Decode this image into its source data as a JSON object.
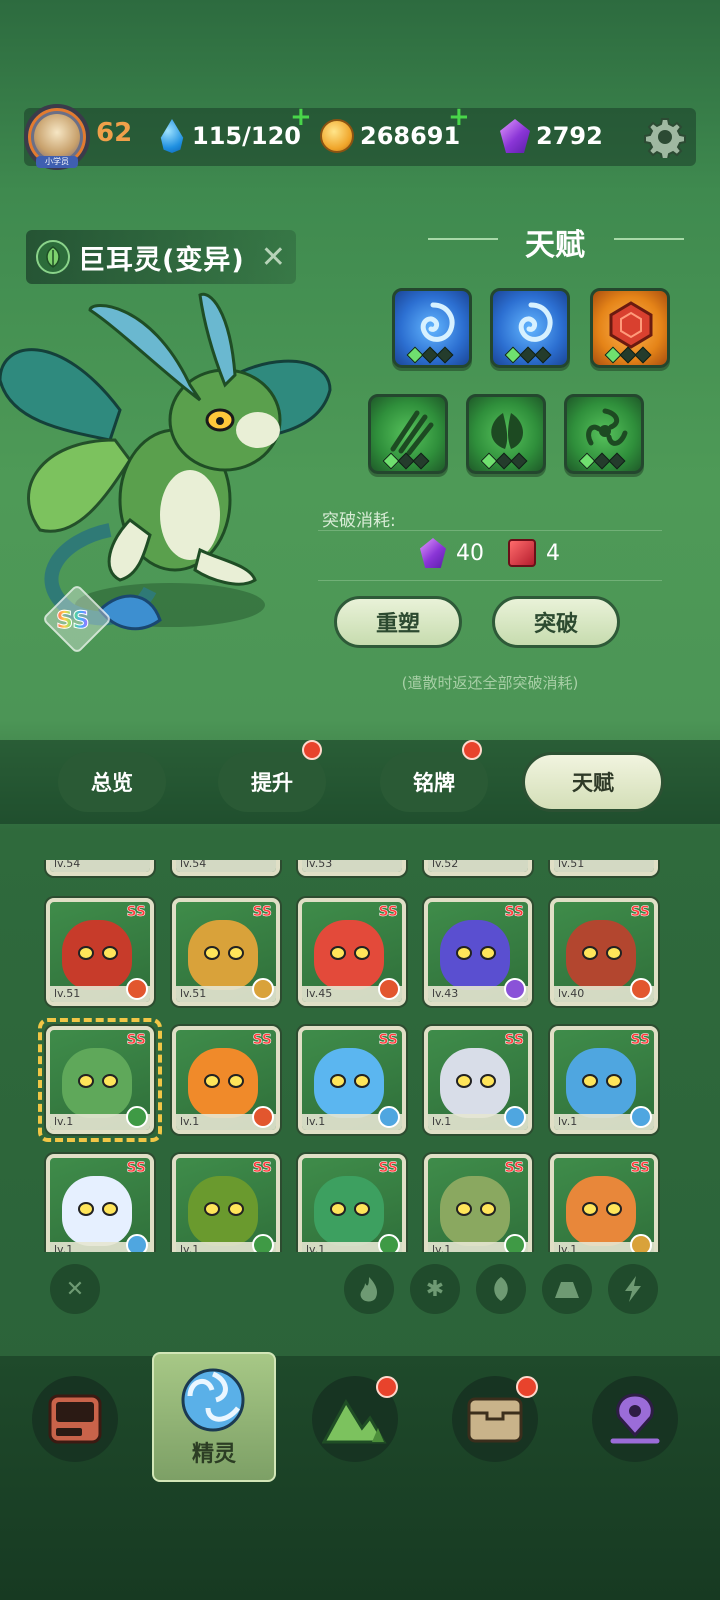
{
  "player": {
    "level": "62",
    "avatar_tag": "小学员"
  },
  "resources": {
    "water": "115/120",
    "coins": "268691",
    "gems": "2792"
  },
  "pet": {
    "name": "巨耳灵(变异)",
    "rarity": "SS"
  },
  "talent": {
    "title": "天赋",
    "slots_row1": [
      {
        "icon": "spiral-icon",
        "color": "blue",
        "level": 1
      },
      {
        "icon": "spiral-icon",
        "color": "blue",
        "level": 1
      },
      {
        "icon": "gem-shield-icon",
        "color": "orange",
        "level": 1
      }
    ],
    "slots_row2": [
      {
        "icon": "claw-icon",
        "color": "green",
        "level": 1
      },
      {
        "icon": "leaves-icon",
        "color": "green",
        "level": 1
      },
      {
        "icon": "whirl-icon",
        "color": "green",
        "level": 1
      }
    ],
    "break_label": "突破消耗:",
    "cost_gems": "40",
    "cost_books": "4",
    "reshape_button": "重塑",
    "break_button": "突破",
    "hint": "(遣散时返还全部突破消耗)"
  },
  "tabs": [
    {
      "label": "总览",
      "badge": false
    },
    {
      "label": "提升",
      "badge": true
    },
    {
      "label": "铭牌",
      "badge": true
    },
    {
      "label": "天赋",
      "badge": false,
      "active": true
    }
  ],
  "grid": {
    "top_row_levels": [
      "lv.54",
      "lv.54",
      "lv.53",
      "lv.52",
      "lv.51"
    ],
    "rows": [
      [
        {
          "lv": "lv.51",
          "rarity": "SS",
          "element": "fire",
          "color": "#c73b2a"
        },
        {
          "lv": "lv.51",
          "rarity": "SS",
          "element": "earth",
          "color": "#d9a23a"
        },
        {
          "lv": "lv.45",
          "rarity": "SS",
          "element": "fire",
          "color": "#e34a3a"
        },
        {
          "lv": "lv.43",
          "rarity": "SS",
          "element": "lightning",
          "color": "#5a4fd0"
        },
        {
          "lv": "lv.40",
          "rarity": "SS",
          "element": "fire",
          "color": "#b3462f"
        }
      ],
      [
        {
          "lv": "lv.1",
          "rarity": "SS",
          "element": "grass",
          "color": "#5fa85a",
          "selected": true
        },
        {
          "lv": "lv.1",
          "rarity": "SS",
          "element": "fire",
          "color": "#f08a2a"
        },
        {
          "lv": "lv.1",
          "rarity": "SS",
          "element": "ice",
          "color": "#5bb6f0"
        },
        {
          "lv": "lv.1",
          "rarity": "SS",
          "element": "ice",
          "color": "#d8dde8"
        },
        {
          "lv": "lv.1",
          "rarity": "SS",
          "element": "ice",
          "color": "#4fa6e0"
        }
      ],
      [
        {
          "lv": "lv.1",
          "rarity": "SS",
          "element": "ice",
          "color": "#e6f0ff"
        },
        {
          "lv": "lv.1",
          "rarity": "SS",
          "element": "grass",
          "color": "#6a9a2e"
        },
        {
          "lv": "lv.1",
          "rarity": "SS",
          "element": "grass",
          "color": "#3da060"
        },
        {
          "lv": "lv.1",
          "rarity": "SS",
          "element": "grass",
          "color": "#8aa860"
        },
        {
          "lv": "lv.1",
          "rarity": "SS",
          "element": "earth",
          "color": "#e8873a"
        }
      ]
    ]
  },
  "filters": [
    "close",
    "fire",
    "ice",
    "grass",
    "earth",
    "lightning"
  ],
  "bottom_nav": {
    "active_label": "精灵",
    "items": [
      "device-icon",
      "pet-spiral-icon",
      "mountain-icon",
      "chest-icon",
      "map-pin-icon"
    ]
  },
  "colors": {
    "accent_green": "#4e9a57",
    "level_orange": "#f0a04a",
    "badge_red": "#e8432c"
  }
}
